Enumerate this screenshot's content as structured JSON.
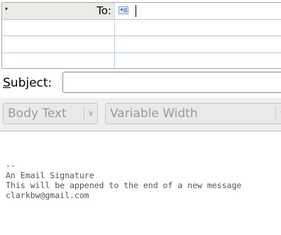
{
  "recipients": {
    "rows": [
      {
        "type": "To:",
        "value": ""
      },
      {
        "type": "",
        "value": ""
      },
      {
        "type": "",
        "value": ""
      },
      {
        "type": "",
        "value": ""
      }
    ]
  },
  "subject": {
    "label_first": "S",
    "label_rest": "ubject:",
    "value": ""
  },
  "format_toolbar": {
    "paragraph_style": "Body Text",
    "font": "Variable Width"
  },
  "message_body": {
    "lines": [
      "--",
      "An Email Signature",
      "This will be appened to the end of a new message",
      "clarkbw@gmail.com"
    ]
  }
}
